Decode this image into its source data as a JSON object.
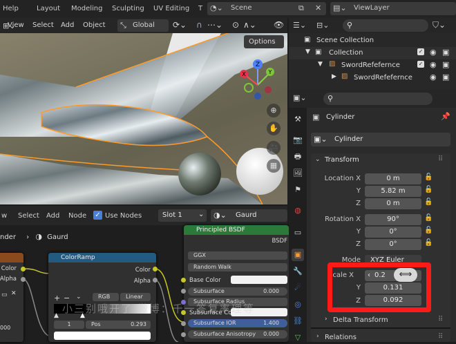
{
  "topbar": {
    "help": "Help",
    "tabs": [
      "Layout",
      "Modeling",
      "Sculpting",
      "UV Editing",
      "T"
    ],
    "scene": "Scene",
    "viewlayer": "ViewLayer"
  },
  "viewport": {
    "menus": [
      "View",
      "Select",
      "Add",
      "Object"
    ],
    "transform_orientation": "Global",
    "options": "Options"
  },
  "gizmo": {
    "z": "Z",
    "y": "Y",
    "x": "X"
  },
  "outliner": {
    "search_placeholder": "",
    "items": [
      "Scene Collection",
      "Collection",
      "SwordRefefernce",
      "SwordRefefernce"
    ]
  },
  "properties": {
    "object_name": "Cylinder",
    "datablock_name": "Cylinder",
    "transform": "Transform",
    "location": {
      "label": "Location X",
      "x": "0 m",
      "y": "5.82 m",
      "z": "0 m"
    },
    "rotation": {
      "label": "Rotation X",
      "x": "90°",
      "y": "0°",
      "z": "0°"
    },
    "mode": {
      "label": "Mode",
      "value": "XYZ Euler"
    },
    "scale": {
      "label": "Scale X",
      "x": "0.2",
      "y": "0.131",
      "z": "0.092"
    },
    "axis_labels": {
      "y": "Y",
      "z": "Z"
    },
    "delta_transform": "Delta Transform",
    "relations": "Relations"
  },
  "node_editor": {
    "menus": [
      "w",
      "Select",
      "Add",
      "Node"
    ],
    "use_nodes": "Use Nodes",
    "slot": "Slot 1",
    "material": "Gaurd",
    "breadcrumb_left": "nder",
    "breadcrumb_material": "Gaurd",
    "left_node": {
      "color": "Color",
      "alpha": "Alpha",
      "value": "000"
    },
    "colorramp": {
      "title": "ColorRamp",
      "color": "Color",
      "alpha": "Alpha",
      "mode": "RGB",
      "interp": "Linear",
      "index": "1",
      "pos_label": "Pos",
      "pos": "0.293"
    },
    "bsdf": {
      "title": "Principled BSDF",
      "bsdf": "BSDF",
      "distribution": "GGX",
      "subsurface_method": "Random Walk",
      "base_color": "Base Color",
      "subsurface": "Subsurface",
      "subsurface_value": "0.000",
      "subsurface_radius": "Subsurface Radius",
      "subsurface_color": "Subsurface Col...",
      "subsurface_ior": "Subsurface IOR",
      "subsurface_ior_value": "1.400",
      "subsurface_aniso": "Subsurface Anisotropy",
      "subsurface_aniso_value": "0.000"
    }
  },
  "watermark": "小三别哦开了  微博：千一答复率理等"
}
